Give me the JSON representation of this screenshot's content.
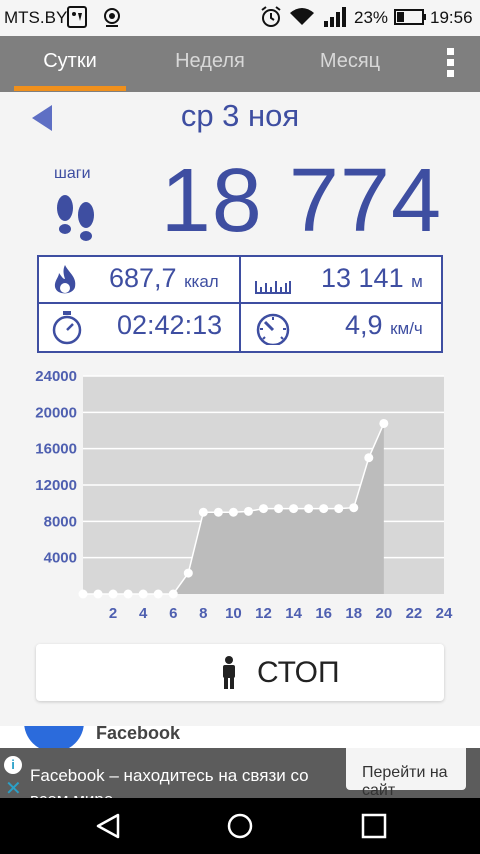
{
  "status_bar": {
    "carrier": "MTS.BY",
    "battery_percent": "23%",
    "time": "19:56",
    "icons": [
      "usb-debug-icon",
      "location-icon",
      "alarm-icon",
      "wifi-icon",
      "signal-icon",
      "battery-icon"
    ]
  },
  "tabs": [
    {
      "label": "Сутки",
      "active": true
    },
    {
      "label": "Неделя",
      "active": false
    },
    {
      "label": "Месяц",
      "active": false
    }
  ],
  "date": "ср 3 ноя",
  "steps": {
    "label": "шаги",
    "value": "18 774"
  },
  "stats": {
    "calories": {
      "value": "687,7",
      "unit": "ккал"
    },
    "distance": {
      "value": "13 141",
      "unit": "м"
    },
    "duration": {
      "value": "02:42:13"
    },
    "speed": {
      "value": "4,9",
      "unit": "км/ч"
    }
  },
  "chart_data": {
    "type": "area",
    "x": [
      0,
      1,
      2,
      3,
      4,
      5,
      6,
      7,
      8,
      9,
      10,
      11,
      12,
      13,
      14,
      15,
      16,
      17,
      18,
      19,
      20
    ],
    "values": [
      0,
      0,
      0,
      0,
      0,
      0,
      0,
      2300,
      9000,
      9000,
      9000,
      9100,
      9400,
      9400,
      9400,
      9400,
      9400,
      9400,
      9500,
      15000,
      18774
    ],
    "x_ticks": [
      "2",
      "4",
      "6",
      "8",
      "10",
      "12",
      "14",
      "16",
      "18",
      "20",
      "22",
      "24"
    ],
    "y_ticks": [
      "4000",
      "8000",
      "12000",
      "16000",
      "20000",
      "24000"
    ],
    "xlim": [
      0,
      24
    ],
    "ylim": [
      0,
      24000
    ],
    "grid": true,
    "colors": {
      "plot_bg": "#d7d7d7",
      "area": "#bcbcbc",
      "line": "#ffffff",
      "axis_text": "#4e5fb0"
    }
  },
  "stop_button": {
    "label": "СТОП"
  },
  "ad": {
    "app_name": "Facebook",
    "text": "Facebook – находитесь на связи со всем мире",
    "cta": "Перейти на сайт"
  },
  "colors": {
    "accent_blue": "#3e4ea1",
    "tab_bar": "#7f7f7f",
    "tab_underline": "#f0901c"
  }
}
